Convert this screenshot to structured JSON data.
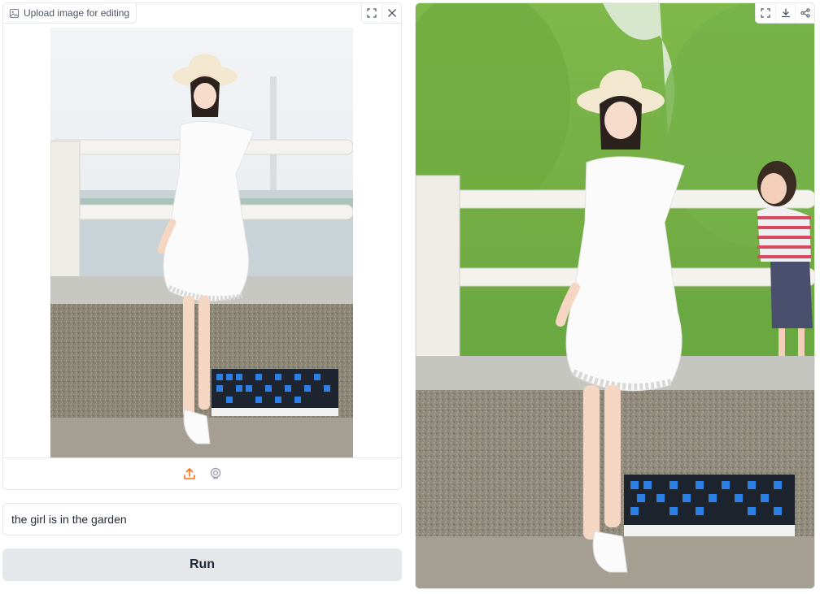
{
  "input_panel": {
    "label": "Upload image for editing",
    "label_icon": "image-icon",
    "tools": [
      "fullscreen-icon",
      "close-icon"
    ],
    "source_buttons": [
      "upload-icon",
      "webcam-icon"
    ]
  },
  "prompt": {
    "value": "the girl is in the garden",
    "placeholder": ""
  },
  "run_button": {
    "label": "Run"
  },
  "output_panel": {
    "tools": [
      "fullscreen-icon",
      "download-icon",
      "share-icon"
    ]
  },
  "colors": {
    "accent": "#f97316",
    "button_bg": "#e5e7eb",
    "border": "#e5e7eb"
  }
}
